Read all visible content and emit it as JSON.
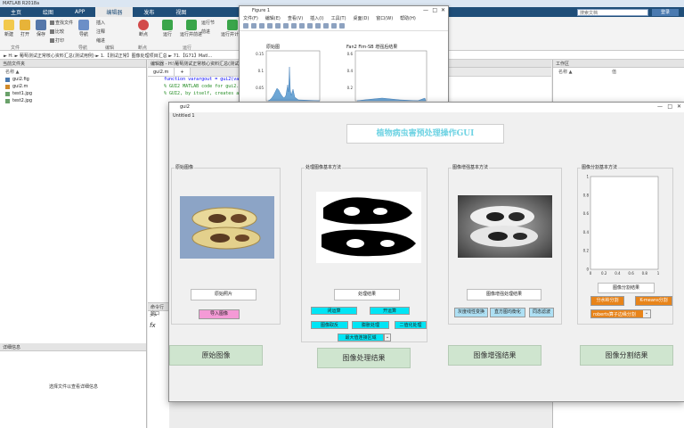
{
  "matlab": {
    "title": "MATLAB R2018a",
    "tabs": [
      "主页",
      "绘图",
      "APP",
      "编辑器",
      "发布",
      "视图"
    ],
    "active_tab": "编辑器",
    "search_placeholder": "搜索文档",
    "login_label": "登录",
    "ribbon": {
      "new": "新建",
      "open": "打开",
      "save": "保存",
      "find_files": "查找文件",
      "compare": "比较",
      "print": "打印",
      "navigate": "导航",
      "insert": "插入",
      "comment": "注释",
      "indent": "缩进",
      "breakpoint": "断点",
      "run": "运行",
      "run_advance": "运行并前进",
      "run_section": "运行节",
      "advance": "前进",
      "run_time": "运行并计时",
      "group_file": "文件",
      "group_nav": "导航",
      "group_edit": "编辑",
      "group_bp": "断点",
      "group_run": "运行"
    },
    "path": "► H: ► 葡萄测试正常核心资料汇总(测试用例) ► 1.【测试正常】图像处理项目汇总 ► 71.【G71】Matl...",
    "file_panel": {
      "title": "当前文件夹",
      "col_name": "名称 ▲",
      "files": [
        "gui2.fig",
        "gui2.m",
        "test1.jpg",
        "test2.jpg"
      ]
    },
    "details": {
      "title": "详细信息",
      "message": "选择文件以查看详细信息"
    },
    "editor": {
      "title": "编辑器 - H:\\葡萄测试正常核心资料汇总(测试用例)\\...\\gui2.m",
      "tab": "gui2.m",
      "lines": [
        "function varargout = gui2(varargin)",
        "% GUI2 MATLAB code for gui2.fig",
        "%      GUI2, by itself, creates a new GUI2 or raises the existing"
      ]
    },
    "cmd": {
      "title": "命令行窗口",
      "prompt": ">>",
      "fx": "fx"
    },
    "workspace": {
      "title": "工作区",
      "col_name": "名称 ▲",
      "col_value": "值"
    }
  },
  "figure1": {
    "title": "Figure 1",
    "menus": [
      "文件(F)",
      "编辑(E)",
      "查看(V)",
      "插入(I)",
      "工具(T)",
      "桌面(D)",
      "窗口(W)",
      "帮助(H)"
    ],
    "ax1_title": "原始图",
    "ax2_title": "Fan2 Fim-SB 增强后结果"
  },
  "gui2": {
    "title": "gui2",
    "subtitle": "Untitled 1",
    "main_title": "植物病虫害预处理操作GUI",
    "panel1": {
      "title": "原始图像",
      "caption": "原始照片",
      "btn_import": "导入图像"
    },
    "panel2": {
      "title": "处理图像基本方法",
      "caption": "处理结果",
      "buttons": [
        "闭运算",
        "开运算",
        "图像取反",
        "膨胀处理",
        "二值化处理",
        "最大值连接区域"
      ]
    },
    "panel3": {
      "title": "图像增强基本方法",
      "caption": "图像增强处理结果",
      "buttons": [
        "灰度线性变换",
        "直方图均衡化",
        "同态滤波"
      ]
    },
    "panel4": {
      "title": "图像分割基本方法",
      "caption": "图像分割结果",
      "buttons": [
        "分水岭分割",
        "K-means分割"
      ],
      "select": "roberts算子边缘分割"
    },
    "bottom_buttons": [
      "原始图像",
      "图像处理结果",
      "图像增强结果",
      "图像分割结果"
    ]
  },
  "colors": {
    "matlab_blue": "#1f4e79",
    "cyan_button": "#00e5f5",
    "orange_button": "#e8841a",
    "pink_button": "#f49ad6"
  },
  "chart_data": {
    "type": "area",
    "title": "",
    "xlabel": "",
    "ylabel": "",
    "ylim": [
      0,
      1
    ],
    "xlim": [
      0,
      1
    ],
    "xticks": [
      "0",
      "0.2",
      "0.4",
      "0.6",
      "0.8",
      "1"
    ],
    "yticks": [
      "0",
      "0.2",
      "0.4",
      "0.6",
      "0.8",
      "1"
    ],
    "values": []
  }
}
